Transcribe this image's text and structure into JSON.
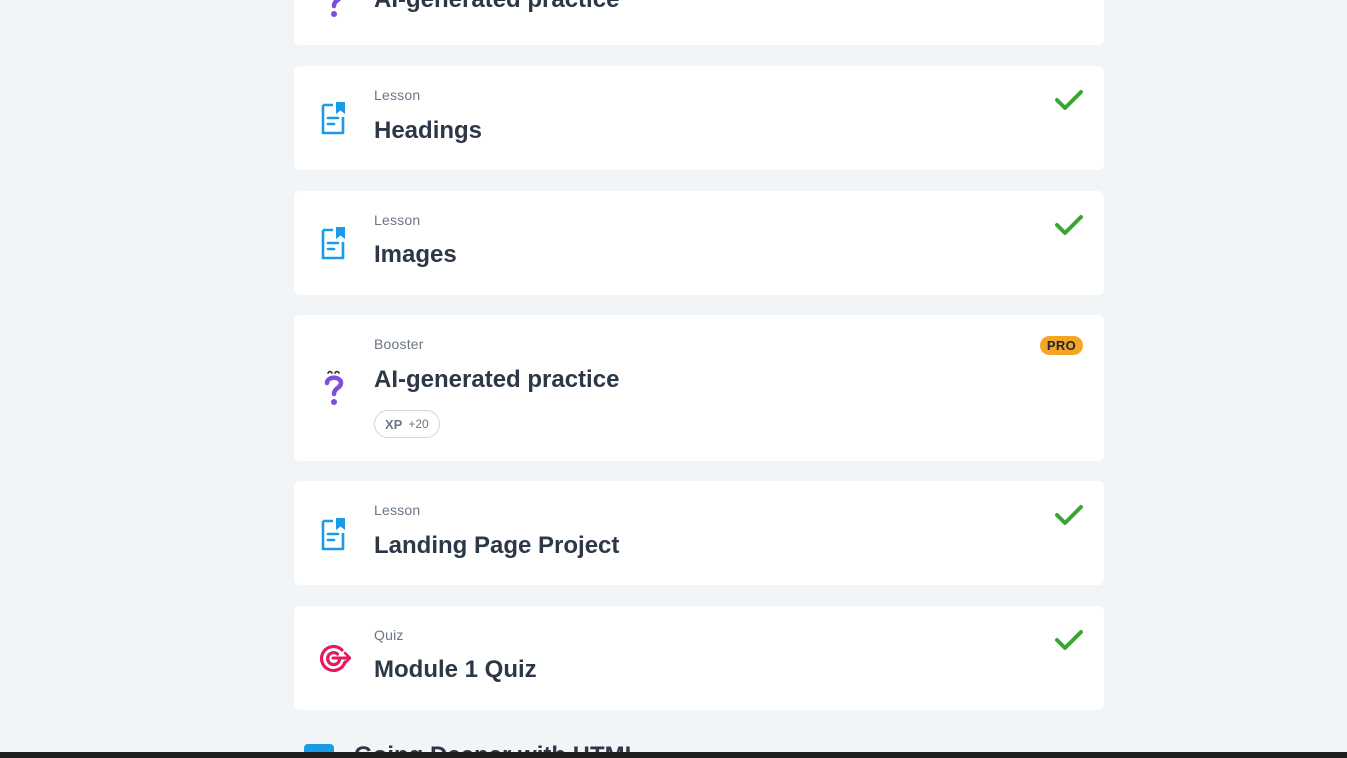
{
  "cards": [
    {
      "type": "",
      "title": "AI-generated practice"
    },
    {
      "type": "Lesson",
      "title": "Headings",
      "icon": "lesson-doc-icon",
      "completed": true
    },
    {
      "type": "Lesson",
      "title": "Images",
      "icon": "lesson-doc-icon",
      "completed": true
    },
    {
      "type": "Booster",
      "title": "AI-generated practice",
      "icon": "question-mark-icon",
      "badge": "PRO",
      "xp_label": "XP",
      "xp_value": "+20"
    },
    {
      "type": "Lesson",
      "title": "Landing Page Project",
      "icon": "lesson-doc-icon",
      "completed": true
    },
    {
      "type": "Quiz",
      "title": "Module 1 Quiz",
      "icon": "target-icon",
      "completed": true
    }
  ],
  "next_module": {
    "title": "Going Deeper with HTML"
  },
  "colors": {
    "background": "#f2f5f7",
    "card": "#ffffff",
    "check": "#3aa632",
    "lesson_icon": "#1a9be8",
    "booster_icon": "#7b4fd6",
    "quiz_icon": "#e5195e",
    "pro_badge": "#f5a524"
  }
}
